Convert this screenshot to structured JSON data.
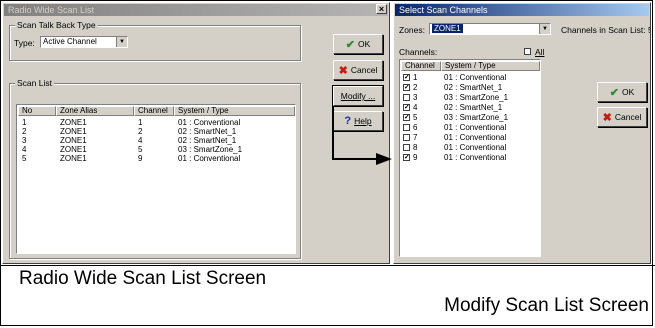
{
  "left_window": {
    "title": "Radio Wide Scan List",
    "close_glyph": "×",
    "talk_back_group": "Scan Talk Back Type",
    "type_label": "Type:",
    "type_value": "Active Channel",
    "scan_list_group": "Scan List",
    "columns": [
      "No",
      "Zone Alias",
      "Channel",
      "System / Type"
    ],
    "rows": [
      {
        "no": "1",
        "zone": "ZONE1",
        "channel": "1",
        "system": "01 : Conventional"
      },
      {
        "no": "2",
        "zone": "ZONE1",
        "channel": "2",
        "system": "02 : SmartNet_1"
      },
      {
        "no": "3",
        "zone": "ZONE1",
        "channel": "4",
        "system": "02 : SmartNet_1"
      },
      {
        "no": "4",
        "zone": "ZONE1",
        "channel": "5",
        "system": "03 : SmartZone_1"
      },
      {
        "no": "5",
        "zone": "ZONE1",
        "channel": "9",
        "system": "01 : Conventional"
      }
    ],
    "ok_label": "OK",
    "cancel_label": "Cancel",
    "modify_label": "Modify ...",
    "help_label": "Help"
  },
  "right_window": {
    "title": "Select Scan Channels",
    "zones_label": "Zones:",
    "zones_value": "ZONE1",
    "channels_in_list_label": "Channels in Scan List: 5",
    "channels_label": "Channels:",
    "all_label": "All",
    "columns": [
      "Channel",
      "System / Type"
    ],
    "rows": [
      {
        "channel": "1",
        "system": "01 : Conventional",
        "checked": true
      },
      {
        "channel": "2",
        "system": "02 : SmartNet_1",
        "checked": true
      },
      {
        "channel": "3",
        "system": "03 : SmartZone_1",
        "checked": false
      },
      {
        "channel": "4",
        "system": "02 : SmartNet_1",
        "checked": true
      },
      {
        "channel": "5",
        "system": "03 : SmartZone_1",
        "checked": true
      },
      {
        "channel": "6",
        "system": "01 : Conventional",
        "checked": false
      },
      {
        "channel": "7",
        "system": "01 : Conventional",
        "checked": false
      },
      {
        "channel": "8",
        "system": "01 : Conventional",
        "checked": false
      },
      {
        "channel": "9",
        "system": "01 : Conventional",
        "checked": true
      }
    ],
    "ok_label": "OK",
    "cancel_label": "Cancel"
  },
  "captions": {
    "left": "Radio Wide Scan List Screen",
    "right": "Modify Scan List Screen"
  },
  "icons": {
    "ok": "checkmark-icon",
    "cancel": "x-icon",
    "help": "question-icon",
    "check": "✓",
    "ok_glyph": "✔",
    "cancel_glyph": "✖",
    "help_glyph": "?"
  },
  "colors": {
    "active_title": "#0a246a",
    "inactive_title": "#808080",
    "ok_green": "#2a8a2a",
    "cancel_red": "#c02010"
  }
}
